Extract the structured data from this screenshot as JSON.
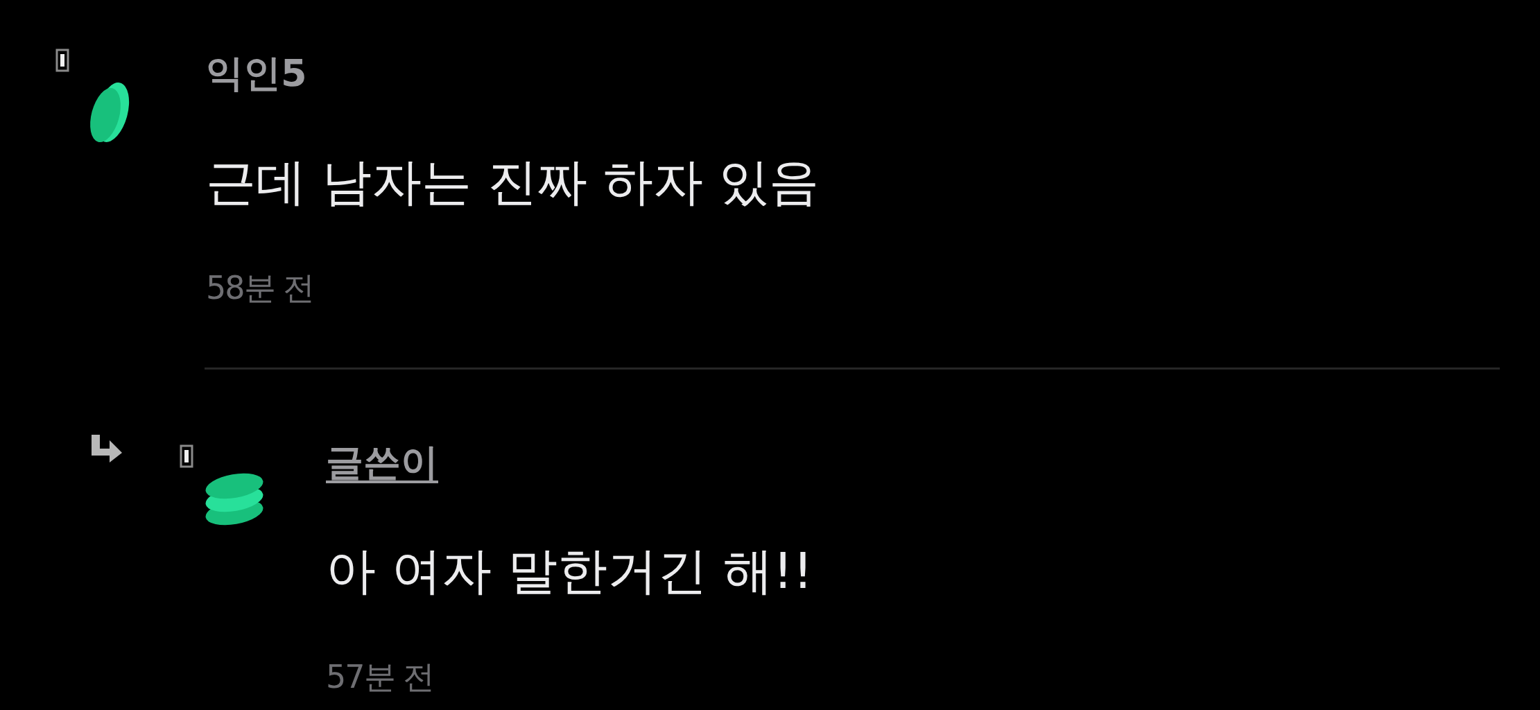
{
  "comments": [
    {
      "kind": "comment",
      "avatar": {
        "kind": "coin"
      },
      "author_name": "익인5",
      "is_author": false,
      "text": "근데 남자는 진짜 하자 있음",
      "time": "58분 전"
    },
    {
      "kind": "reply",
      "avatar": {
        "kind": "stack"
      },
      "author_name": "글쓴이",
      "is_author": true,
      "text": "아 여자 말한거긴 해!!",
      "time": "57분 전"
    }
  ]
}
